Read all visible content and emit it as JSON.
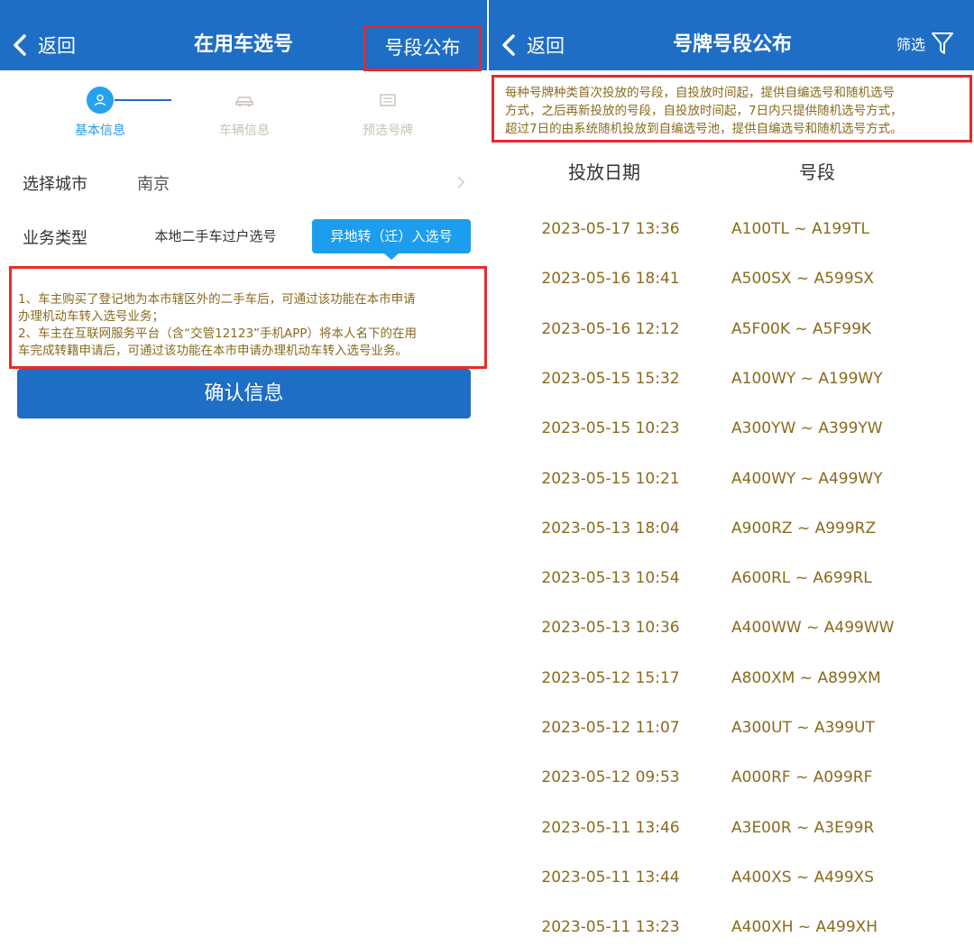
{
  "left": {
    "nav": {
      "back_label": "返回",
      "title": "在用车选号",
      "publish_link": "号段公布"
    },
    "steps": [
      {
        "label": "基本信息",
        "icon": "user-icon",
        "active": true
      },
      {
        "label": "车辆信息",
        "icon": "car-icon",
        "active": false
      },
      {
        "label": "预选号牌",
        "icon": "plate-icon",
        "active": false
      }
    ],
    "city": {
      "label": "选择城市",
      "value": "南京"
    },
    "business": {
      "label": "业务类型",
      "options": [
        "本地二手车过户选号",
        "异地转（迁）入选号"
      ],
      "selected": "异地转（迁）入选号"
    },
    "notes": [
      "1、车主购买了登记地为本市辖区外的二手车后，可通过该功能在本市申请",
      "办理机动车转入选号业务；",
      "2、车主在互联网服务平台（含“交管12123”手机APP）将本人名下的在用",
      "车完成转籍申请后，可通过该功能在本市申请办理机动车转入选号业务。"
    ],
    "confirm_label": "确认信息"
  },
  "right": {
    "nav": {
      "back_label": "返回",
      "title": "号牌号段公布",
      "filter_label": "筛选"
    },
    "rules": [
      "每种号牌种类首次投放的号段，自投放时间起，提供自编选号和随机选号",
      "方式，之后再新投放的号段，自投放时间起，7日内只提供随机选号方式，",
      "超过7日的由系统随机投放到自编选号池，提供自编选号和随机选号方式。"
    ],
    "table": {
      "headers": [
        "投放日期",
        "号段"
      ],
      "rows": [
        [
          "2023-05-17 13:36",
          "A100TL ~ A199TL"
        ],
        [
          "2023-05-16 18:41",
          "A500SX ~ A599SX"
        ],
        [
          "2023-05-16 12:12",
          "A5F00K ~ A5F99K"
        ],
        [
          "2023-05-15 15:32",
          "A100WY ~ A199WY"
        ],
        [
          "2023-05-15 10:23",
          "A300YW ~ A399YW"
        ],
        [
          "2023-05-15 10:21",
          "A400WY ~ A499WY"
        ],
        [
          "2023-05-13 18:04",
          "A900RZ ~ A999RZ"
        ],
        [
          "2023-05-13 10:54",
          "A600RL ~ A699RL"
        ],
        [
          "2023-05-13 10:36",
          "A400WW ~ A499WW"
        ],
        [
          "2023-05-12 15:17",
          "A800XM ~ A899XM"
        ],
        [
          "2023-05-12 11:07",
          "A300UT ~ A399UT"
        ],
        [
          "2023-05-12 09:53",
          "A000RF ~ A099RF"
        ],
        [
          "2023-05-11 13:46",
          "A3E00R ~ A3E99R"
        ],
        [
          "2023-05-11 13:44",
          "A400XS ~ A499XS"
        ],
        [
          "2023-05-11 13:23",
          "A400XH ~ A499XH"
        ]
      ]
    }
  },
  "colors": {
    "navbar": "#1f6ec6",
    "accent": "#1d9ded",
    "highlight_border": "#e8282a",
    "note_text": "#8a6a1e"
  }
}
